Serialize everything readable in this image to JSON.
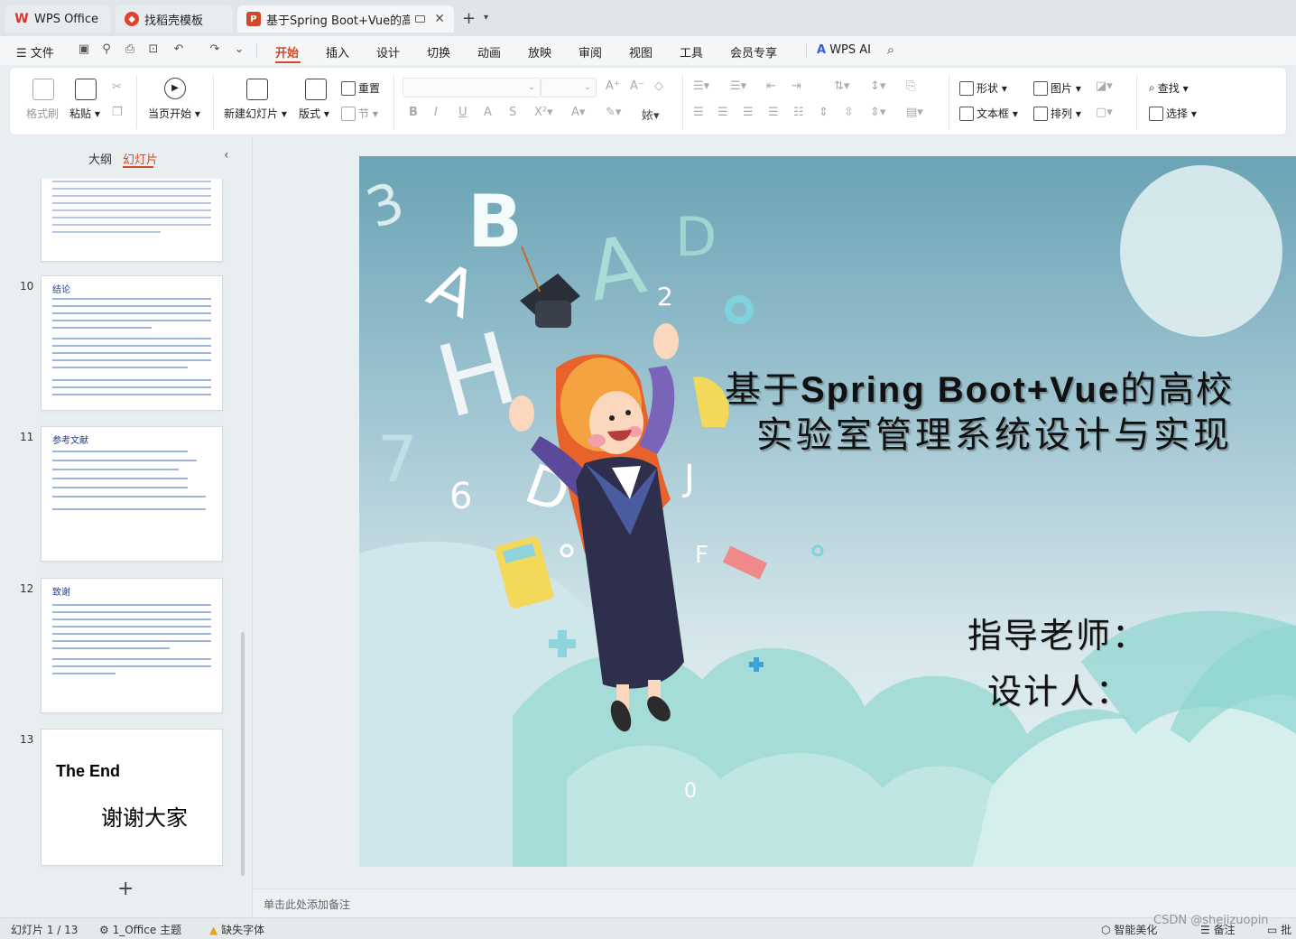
{
  "tabs": {
    "wps": "WPS Office",
    "template": "找稻壳模板",
    "doc": "基于Spring Boot+Vue的高校"
  },
  "menu": {
    "file": "文件",
    "home": "开始",
    "insert": "插入",
    "design": "设计",
    "transition": "切换",
    "animation": "动画",
    "slideshow": "放映",
    "review": "审阅",
    "view": "视图",
    "tools": "工具",
    "member": "会员专享",
    "ai": "WPS AI"
  },
  "ribbon": {
    "format_painter": "格式刷",
    "paste": "粘贴",
    "start_from_current": "当页开始",
    "new_slide": "新建幻灯片",
    "layout": "版式",
    "reset": "重置",
    "section": "节",
    "shape": "形状",
    "picture": "图片",
    "find": "查找",
    "textbox": "文本框",
    "arrange": "排列",
    "select": "选择"
  },
  "panel": {
    "outline": "大纲",
    "slides": "幻灯片",
    "thumbs": [
      {
        "num": "10",
        "title": "结论"
      },
      {
        "num": "11",
        "title": "参考文献"
      },
      {
        "num": "12",
        "title": "致谢"
      },
      {
        "num": "13",
        "title": "The End",
        "subtitle": "谢谢大家"
      }
    ]
  },
  "slide": {
    "title_line1_prefix": "基于",
    "title_line1_bold": "Spring Boot+Vue",
    "title_line1_suffix": "的高校",
    "title_line2": "实验室管理系统设计与实现",
    "advisor": "指导老师：",
    "designer": "设计人："
  },
  "notes": {
    "placeholder": "单击此处添加备注"
  },
  "status": {
    "slide_counter": "幻灯片 1 / 13",
    "theme": "1_Office 主题",
    "missing_font": "缺失字体",
    "smart_beautify": "智能美化",
    "notes": "备注",
    "comments": "批",
    "watermark": "CSDN @shejizuopin"
  },
  "colors": {
    "accent": "#d24726",
    "slide_bg_top": "#6aa3b5",
    "cloud": "#8ed6d2"
  }
}
